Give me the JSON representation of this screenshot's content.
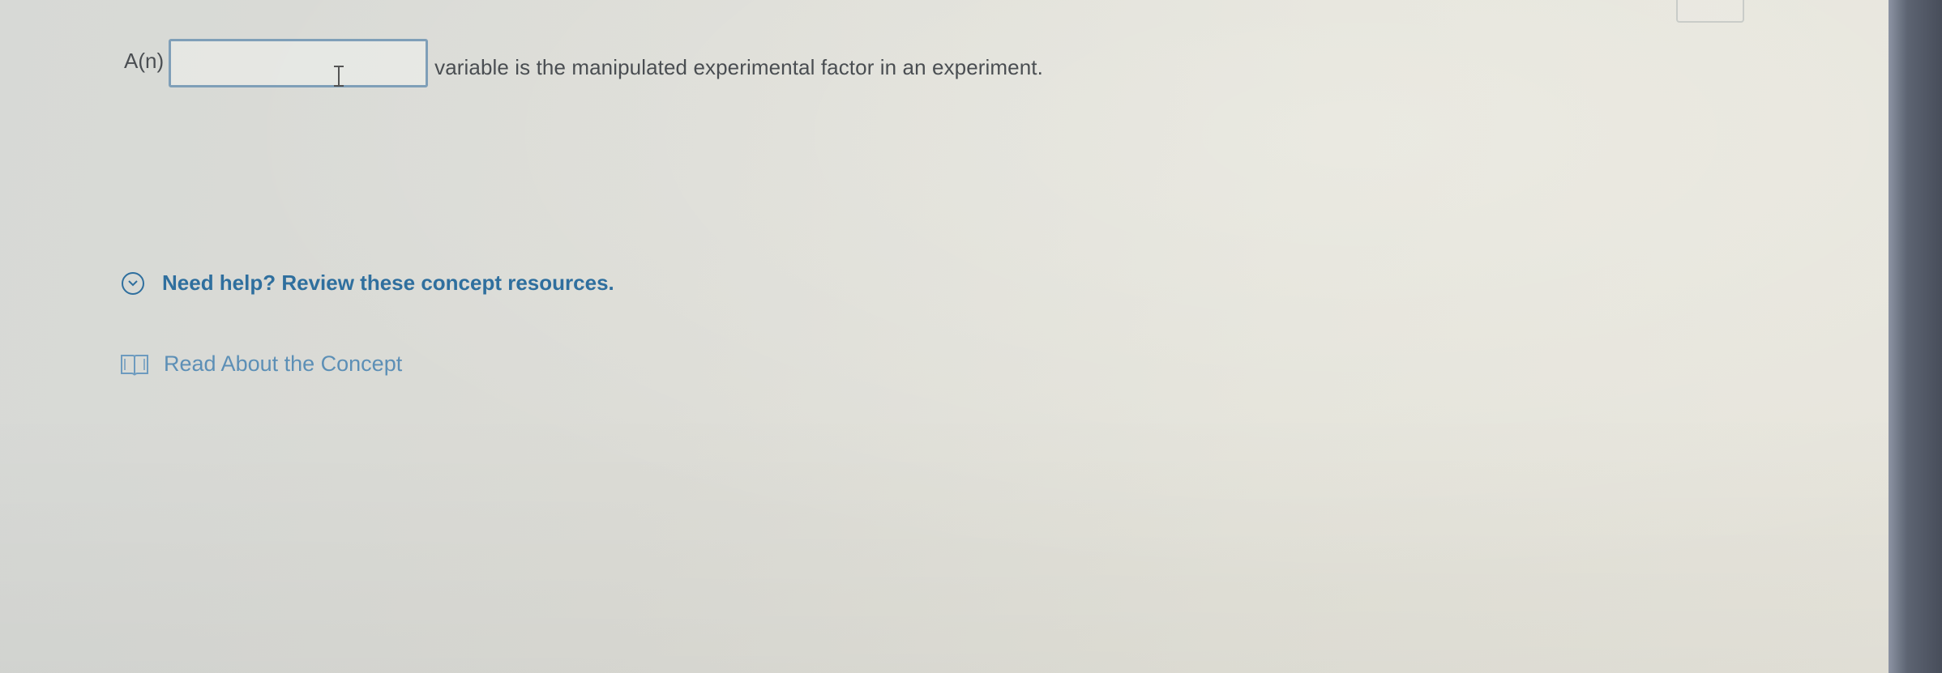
{
  "question": {
    "prefix": "A(n)",
    "input_value": "",
    "suffix": "variable is the manipulated experimental factor in an experiment."
  },
  "help": {
    "toggle_label": "Need help? Review these concept resources.",
    "toggle_icon": "chevron-down-circle-icon"
  },
  "resources": {
    "read_concept_label": "Read About the Concept",
    "read_concept_icon": "book-icon"
  },
  "colors": {
    "link_blue": "#2f6f9e",
    "resource_blue": "#5c8fb6",
    "input_border": "#7f9fb8",
    "text_gray": "#4a4e52"
  }
}
